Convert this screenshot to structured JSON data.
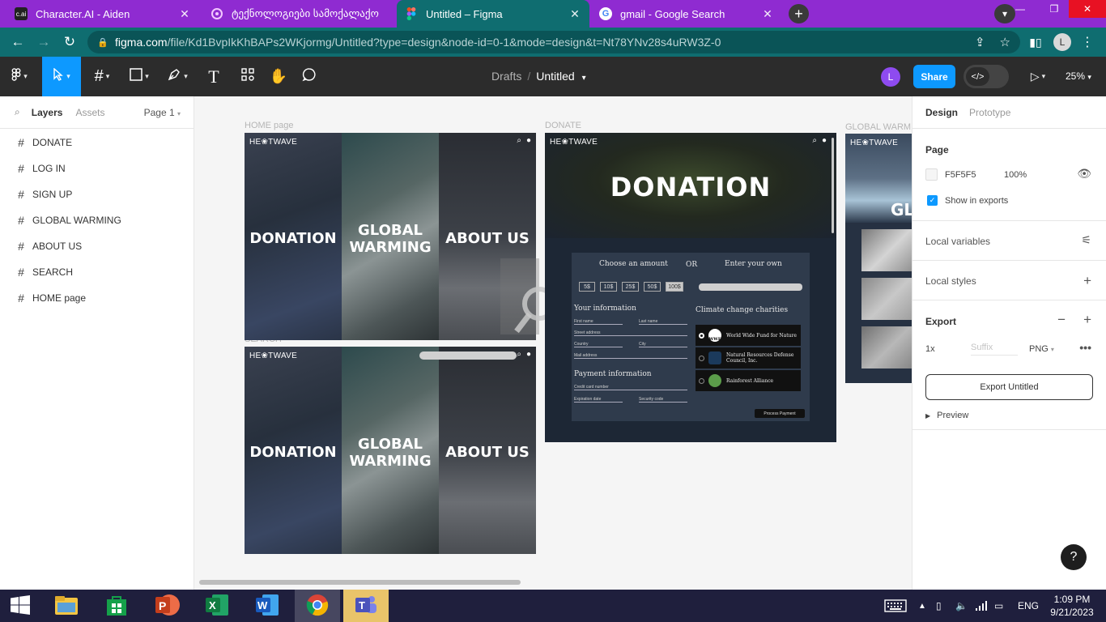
{
  "browser": {
    "tabs": [
      {
        "title": "Character.AI - Aiden",
        "favicon_text": "c.ai",
        "active": false
      },
      {
        "title": "ტექნოლოგიები სამოქალაქო",
        "active": false
      },
      {
        "title": "Untitled – Figma",
        "active": true
      },
      {
        "title": "gmail - Google Search",
        "active": false
      }
    ],
    "new_tab_label": "+",
    "url_host": "figma.com",
    "url_path": "/file/Kd1BvpIkKhBAPs2WKjormg/Untitled?type=design&node-id=0-1&mode=design&t=Nt78YNv28s4uRW3Z-0",
    "profile_initial": "L"
  },
  "figma": {
    "breadcrumb_parent": "Drafts",
    "breadcrumb_sep": "/",
    "file_name": "Untitled",
    "user_initial": "L",
    "share_label": "Share",
    "zoom_label": "25%",
    "left_panel": {
      "tab_layers": "Layers",
      "tab_assets": "Assets",
      "page_selector": "Page 1",
      "layers": [
        "DONATE",
        "LOG IN",
        "SIGN UP",
        "GLOBAL WARMING",
        "ABOUT US",
        "SEARCH",
        "HOME page"
      ]
    },
    "canvas": {
      "frame_labels": {
        "home": "HOME page",
        "donate": "DONATE",
        "global": "GLOBAL WARMING",
        "search": "SEARCH"
      },
      "site_logo": "HE❀TWAVE",
      "nav_columns": [
        "DONATION",
        "GLOBAL WARMING",
        "ABOUT US"
      ],
      "global_partial": "GL",
      "donate": {
        "title": "DONATION",
        "choose_amount": "Choose an amount",
        "or": "OR",
        "enter_own": "Enter your own",
        "amounts": [
          "5$",
          "10$",
          "25$",
          "50$",
          "100$"
        ],
        "your_info": "Your information",
        "fields": [
          "First name",
          "Last name",
          "Street address",
          "Country",
          "City",
          "Mail address"
        ],
        "payment_info": "Payment information",
        "payment_fields": [
          "Credit card number",
          "Expiration date",
          "Security code"
        ],
        "charities_title": "Climate change charities",
        "charities": [
          "World Wide Fund for Nature",
          "Natural Resources Defense Council, Inc.",
          "Rainforest Alliance"
        ],
        "wwf_logo": "WWF",
        "process_button": "Process Payment"
      }
    },
    "right_panel": {
      "tab_design": "Design",
      "tab_prototype": "Prototype",
      "page_heading": "Page",
      "page_color": "F5F5F5",
      "page_opacity": "100%",
      "show_in_exports": "Show in exports",
      "local_variables": "Local variables",
      "local_styles": "Local styles",
      "export_heading": "Export",
      "export_scale": "1x",
      "export_suffix_placeholder": "Suffix",
      "export_format": "PNG",
      "export_button": "Export Untitled",
      "preview": "Preview"
    },
    "help_label": "?"
  },
  "taskbar": {
    "language": "ENG",
    "time": "1:09 PM",
    "date": "9/21/2023"
  }
}
